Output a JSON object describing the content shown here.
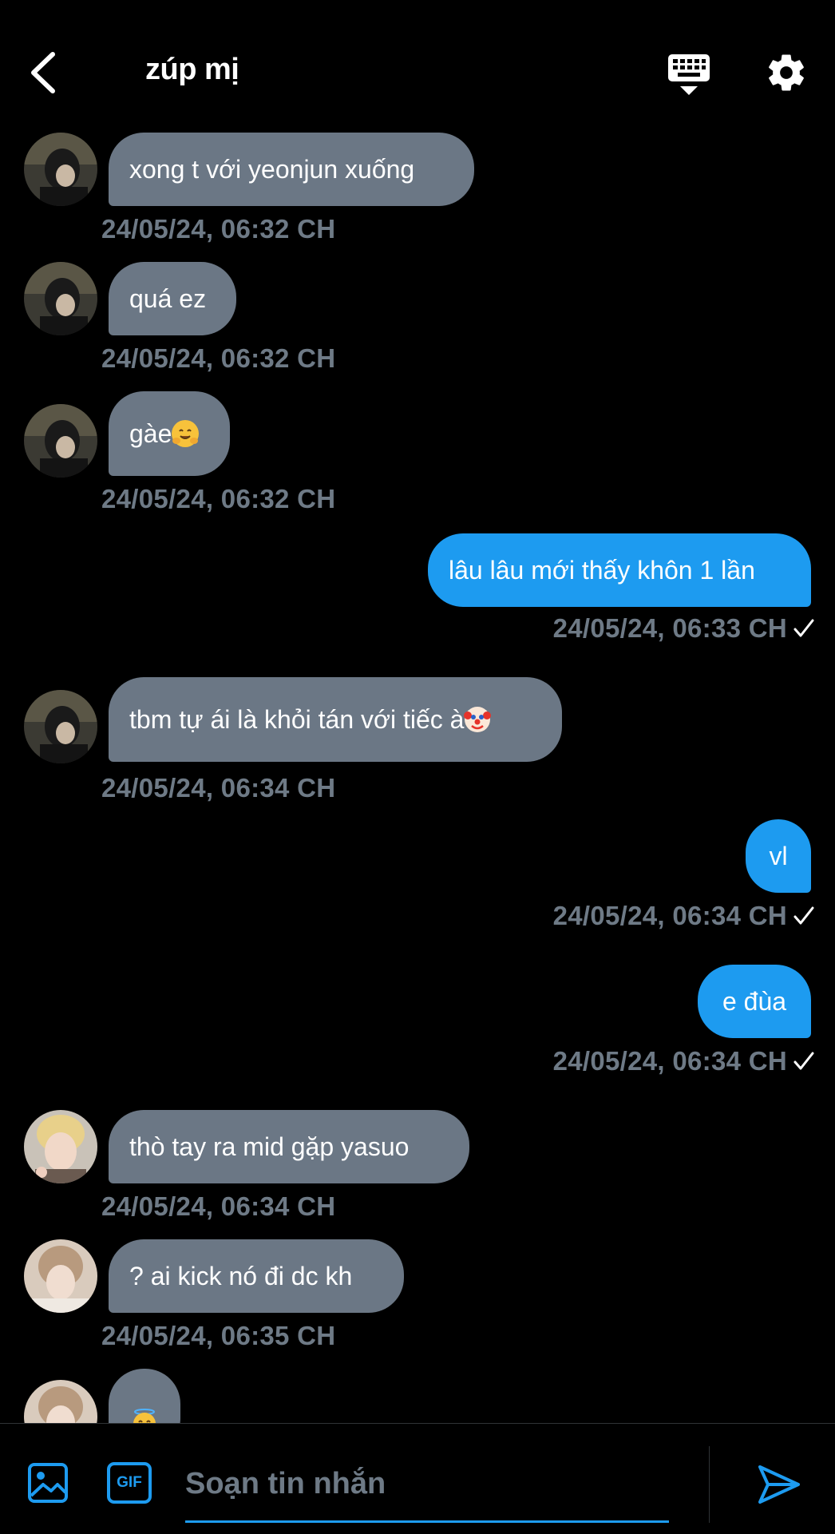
{
  "header": {
    "title": "zúp mị"
  },
  "messages": [
    {
      "direction": "in",
      "text": "xong t với yeonjun xuống",
      "time": "24/05/24, 06:32 CH"
    },
    {
      "direction": "in",
      "text": "quá ez",
      "time": "24/05/24, 06:32 CH"
    },
    {
      "direction": "in",
      "text": "gàe",
      "emoji": "hugging-face",
      "time": "24/05/24, 06:32 CH"
    },
    {
      "direction": "out",
      "text": "lâu lâu mới thấy khôn 1 lần",
      "time": "24/05/24, 06:33 CH"
    },
    {
      "direction": "in",
      "text": "tbm tự ái là khỏi tán với tiếc à",
      "emoji": "clown-face",
      "time": "24/05/24, 06:34 CH"
    },
    {
      "direction": "out",
      "text": "vl",
      "time": "24/05/24, 06:34 CH"
    },
    {
      "direction": "out",
      "text": "e đùa",
      "time": "24/05/24, 06:34 CH"
    },
    {
      "direction": "in",
      "text": "thò tay ra mid gặp yasuo",
      "time": "24/05/24, 06:34 CH"
    },
    {
      "direction": "in",
      "text": "? ai kick nó đi dc kh",
      "time": "24/05/24, 06:35 CH"
    },
    {
      "direction": "in",
      "text": "",
      "emoji": "smiling-face-with-halo"
    }
  ],
  "composer": {
    "placeholder": "Soạn tin nhắn",
    "gif_label": "GIF"
  },
  "colors": {
    "background": "#000000",
    "incoming_bubble": "#6b7785",
    "outgoing_bubble": "#1d9bf0",
    "timestamp": "#6e7a86",
    "accent": "#1d9bf0"
  },
  "icons": {
    "back": "chevron-left-icon",
    "keyboard": "keyboard-icon",
    "settings": "gear-icon",
    "read_receipt": "checkmark-icon",
    "image": "image-icon",
    "gif": "gif-icon",
    "send": "send-icon"
  }
}
